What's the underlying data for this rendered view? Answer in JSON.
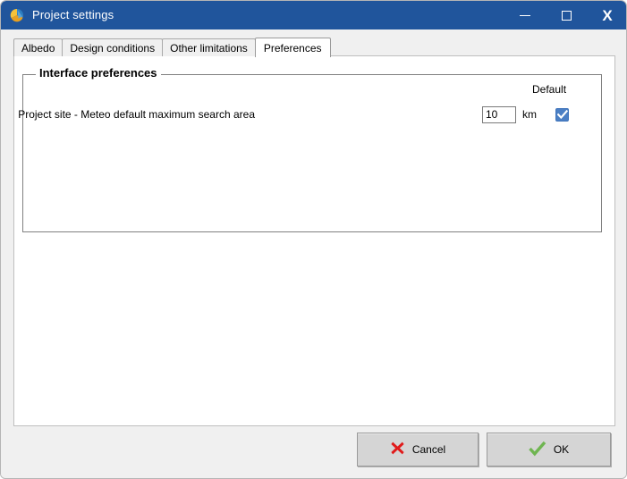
{
  "window": {
    "title": "Project settings",
    "icon": "pvsyst-logo-icon",
    "controls": {
      "minimize": "minimize-icon",
      "maximize": "maximize-icon",
      "close": "X"
    }
  },
  "tabs": [
    {
      "label": "Albedo",
      "active": false
    },
    {
      "label": "Design conditions",
      "active": false
    },
    {
      "label": "Other limitations",
      "active": false
    },
    {
      "label": "Preferences",
      "active": true
    }
  ],
  "group": {
    "legend": "Interface preferences",
    "default_header": "Default",
    "row": {
      "label": "Project site - Meteo default maximum search area",
      "value": "10",
      "unit": "km",
      "default_checked": true
    }
  },
  "footer": {
    "cancel_label": "Cancel",
    "ok_label": "OK"
  },
  "colors": {
    "titlebar": "#20559c",
    "checkbox_blue": "#4b7fc4",
    "cancel_red": "#e01b1b",
    "ok_green": "#6fb551",
    "panel_gray": "#f0f0f0"
  }
}
